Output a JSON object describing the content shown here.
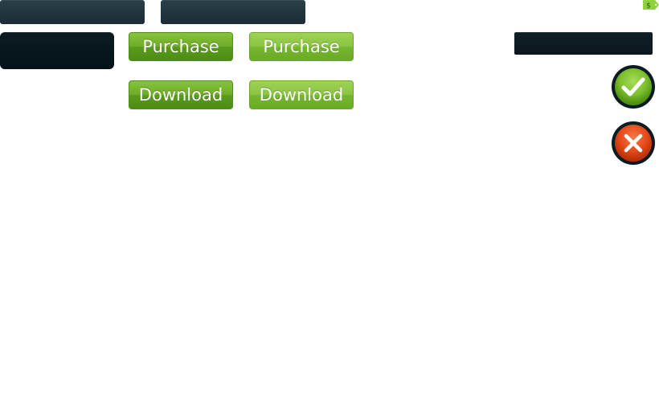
{
  "colors": {
    "dark_bar": "#1f333c",
    "dark_box": "#031218",
    "green_button": "#6aab24",
    "green_button_hover": "#8ac442",
    "confirm_green": "#7cbf2b",
    "cancel_red": "#e64a19"
  },
  "buttons": {
    "purchase_label": "Purchase",
    "purchase_hover_label": "Purchase",
    "download_label": "Download",
    "download_hover_label": "Download"
  },
  "icons": {
    "confirm": "checkmark-icon",
    "cancel": "close-icon",
    "price_tag": "price-tag-icon",
    "price_tag_symbol": "$"
  }
}
